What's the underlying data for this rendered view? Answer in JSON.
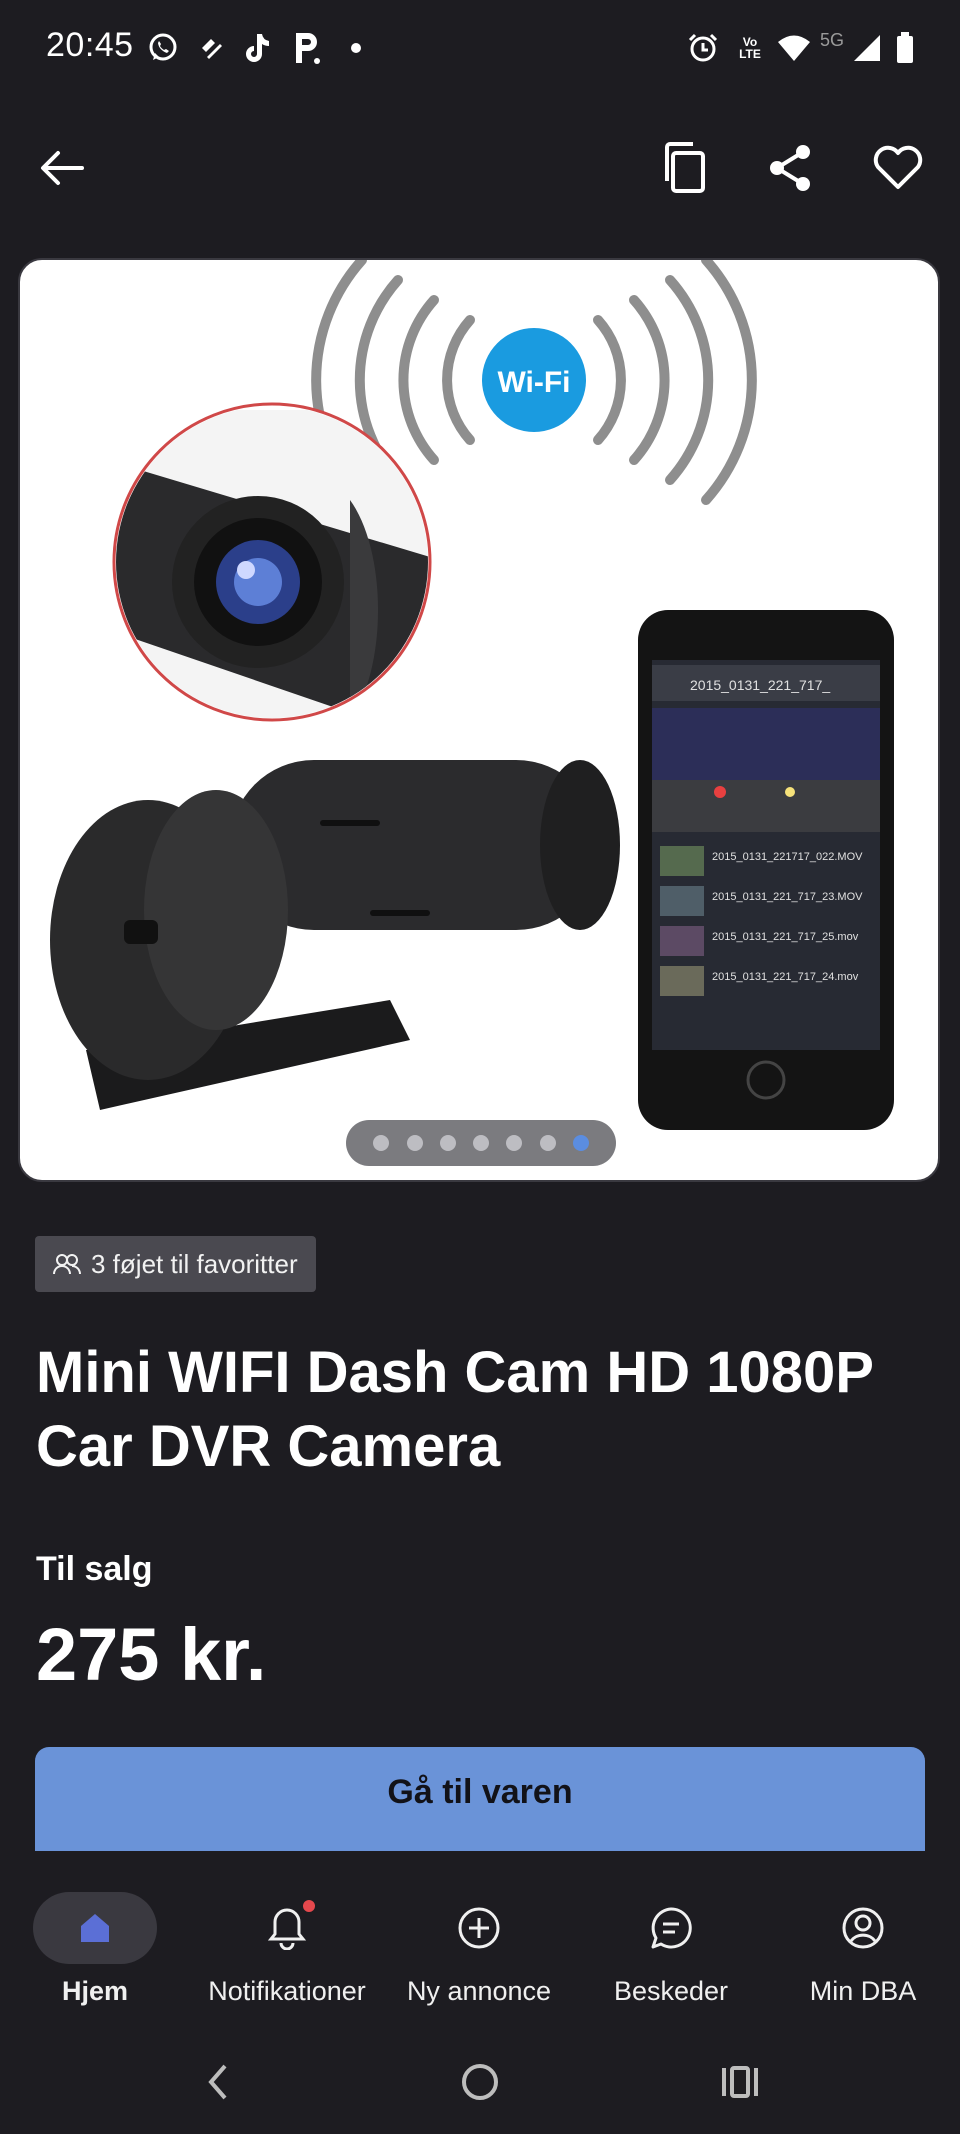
{
  "status_bar": {
    "time": "20:45",
    "left_icons": [
      "whatsapp-icon",
      "app-icon",
      "tiktok-icon",
      "parking-icon",
      "dot-icon"
    ],
    "right_icons": [
      "alarm-icon",
      "volte-icon",
      "wifi-icon",
      "cellular-icon",
      "battery-icon"
    ],
    "network_label": "5G",
    "volte_label": "Vo LTE"
  },
  "top_bar": {
    "icons": [
      "back-arrow-icon",
      "copy-icon",
      "share-icon",
      "heart-icon"
    ]
  },
  "gallery": {
    "image_count": 7,
    "active_index": 6,
    "image_text": {
      "wifi_label": "Wi-Fi",
      "phone_header": "2015_0131_221_717_",
      "files": [
        "2015_0131_221717_022.MOV",
        "2015_0131_221_717_23.MOV",
        "2015_0131_221_717_25.mov",
        "2015_0131_221_717_24.mov"
      ]
    }
  },
  "favorites_badge": {
    "text": "3 føjet til favoritter"
  },
  "listing": {
    "title": "Mini WIFI Dash Cam HD 1080P Car DVR Camera",
    "status": "Til salg",
    "price": "275 kr."
  },
  "cta": {
    "label": "Gå til varen"
  },
  "bottom_nav": {
    "items": [
      {
        "label": "Hjem",
        "icon": "home-icon",
        "active": true
      },
      {
        "label": "Notifikationer",
        "icon": "bell-icon",
        "active": false
      },
      {
        "label": "Ny annonce",
        "icon": "plus-circle-icon",
        "active": false
      },
      {
        "label": "Beskeder",
        "icon": "chat-icon",
        "active": false
      },
      {
        "label": "Min DBA",
        "icon": "user-icon",
        "active": false
      }
    ]
  },
  "colors": {
    "background": "#1d1c21",
    "accent": "#6a93d8",
    "nav_active": "#5b6fd6",
    "notification": "#e5484d"
  }
}
